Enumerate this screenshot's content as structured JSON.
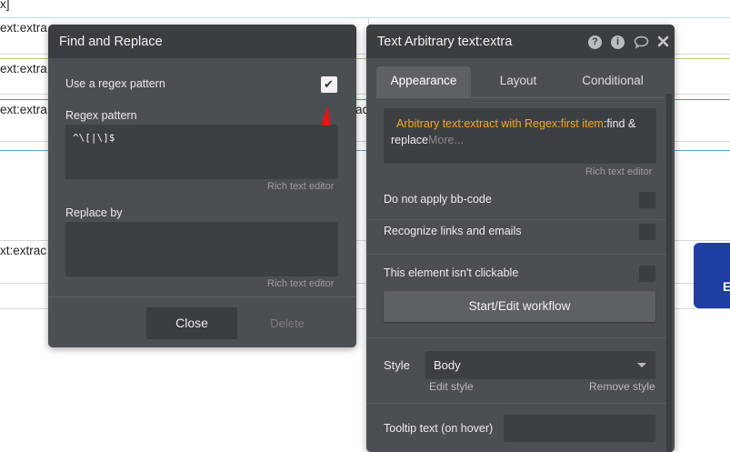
{
  "background": {
    "snippets": [
      "x]",
      "ext:extra",
      "ext:extra",
      "ext:extra",
      "xt:extrac"
    ],
    "snippet_tail": "ac",
    "blue_button_letter": "E"
  },
  "find_replace": {
    "title": "Find and Replace",
    "regex_toggle_label": "Use a regex pattern",
    "regex_checked": true,
    "regex_pattern_label": "Regex pattern",
    "regex_pattern_value": "^\\[|\\]$",
    "rich_text_hint": "Rich text editor",
    "replace_by_label": "Replace by",
    "replace_by_value": "",
    "replace_hint": "Rich text editor",
    "close_label": "Close",
    "delete_label": "Delete"
  },
  "property_editor": {
    "title": "Text Arbitrary text:extra",
    "icons": [
      "help-icon",
      "info-icon",
      "comment-icon",
      "close-icon"
    ],
    "tabs": [
      {
        "label": "Appearance",
        "active": true
      },
      {
        "label": "Layout",
        "active": false
      },
      {
        "label": "Conditional",
        "active": false
      }
    ],
    "expression": {
      "dynamic_part": "Arbitrary text:extract with Regex:first item",
      "static_part": ":find & replace",
      "more": "More..."
    },
    "rich_text_hint": "Rich text editor",
    "options": [
      {
        "label": "Do not apply bb-code",
        "checked": false
      },
      {
        "label": "Recognize links and emails",
        "checked": false
      },
      {
        "label": "This element isn't clickable",
        "checked": false
      }
    ],
    "workflow_button": "Start/Edit workflow",
    "style_label": "Style",
    "style_value": "Body",
    "edit_style": "Edit style",
    "remove_style": "Remove style",
    "tooltip_label": "Tooltip text (on hover)",
    "tooltip_value": ""
  },
  "colors": {
    "panel_bg": "#4c4f52",
    "header_bg": "#3b3e41",
    "dynamic_expression": "#f5a623",
    "blue_button": "#1f3ea4",
    "cursor_red": "#e11111"
  }
}
